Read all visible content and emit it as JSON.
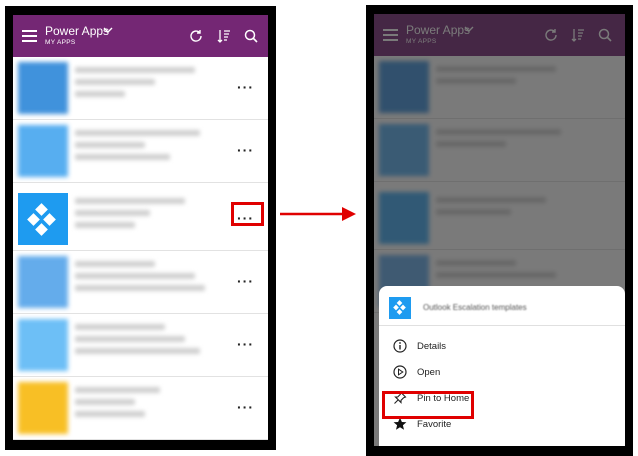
{
  "app": {
    "title": "Power Apps",
    "subtitle": "MY APPS"
  },
  "list": {
    "more_label": "···"
  },
  "sheet": {
    "app_name": "Outlook Escalation templates",
    "menu": [
      {
        "label": "Details",
        "icon": "info-icon"
      },
      {
        "label": "Open",
        "icon": "play-circle-icon"
      },
      {
        "label": "Pin to Home",
        "icon": "pin-icon"
      },
      {
        "label": "Favorite",
        "icon": "star-icon"
      }
    ]
  },
  "colors": {
    "brand_purple": "#742774",
    "highlight_red": "#e00000",
    "tile_blue": "#2196f3",
    "tile_yellow": "#f7b500"
  }
}
